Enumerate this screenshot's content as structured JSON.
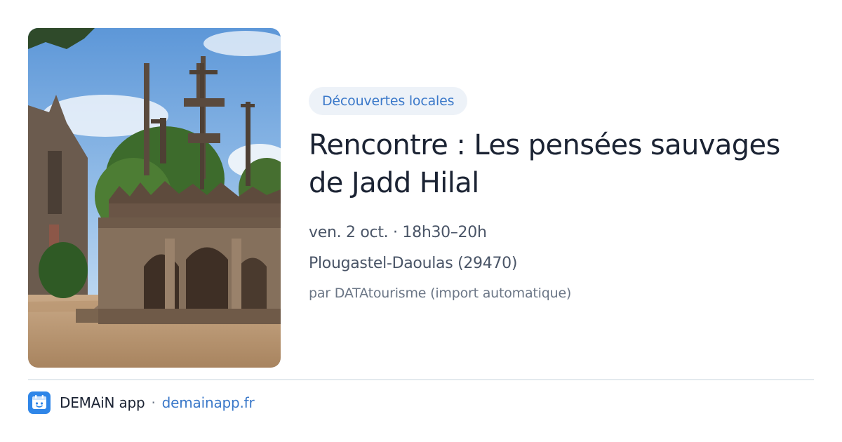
{
  "card": {
    "image_alt": "Calvaire de Plougastel-Daoulas",
    "category": "Découvertes locales",
    "title": "Rencontre : Les pensées sauvages de Jadd Hilal",
    "datetime": "ven. 2 oct. · 18h30–20h",
    "location": "Plougastel-Daoulas (29470)",
    "source": "par DATAtourisme (import automatique)"
  },
  "footer": {
    "logo_icon": "demain-app-logo-icon",
    "app_name": "DEMAiN app",
    "separator": "·",
    "domain": "demainapp.fr"
  },
  "colors": {
    "accent": "#3a78c9",
    "tag_background": "#edf2f8",
    "title": "#1b2333",
    "muted": "#6b7686",
    "logo_background": "#2f86e8"
  }
}
